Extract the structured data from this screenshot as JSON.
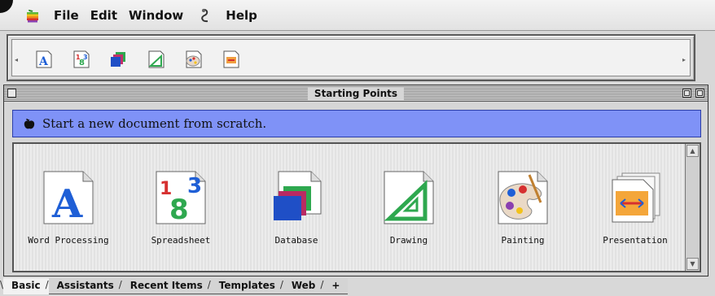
{
  "menubar": {
    "items": [
      "File",
      "Edit",
      "Window",
      "Help"
    ]
  },
  "buttonbar": {
    "buttons": [
      "word-processing",
      "spreadsheet",
      "database",
      "drawing",
      "painting",
      "presentation"
    ]
  },
  "window": {
    "title": "Starting Points",
    "banner": "Start a new document from scratch.",
    "items": [
      {
        "label": "Word Processing",
        "icon": "word-processing-icon"
      },
      {
        "label": "Spreadsheet",
        "icon": "spreadsheet-icon"
      },
      {
        "label": "Database",
        "icon": "database-icon"
      },
      {
        "label": "Drawing",
        "icon": "drawing-icon"
      },
      {
        "label": "Painting",
        "icon": "painting-icon"
      },
      {
        "label": "Presentation",
        "icon": "presentation-icon"
      }
    ]
  },
  "tabs": [
    {
      "label": "Basic",
      "active": true
    },
    {
      "label": "Assistants"
    },
    {
      "label": "Recent Items"
    },
    {
      "label": "Templates"
    },
    {
      "label": "Web"
    },
    {
      "label": "+"
    }
  ],
  "colors": {
    "banner": "#7f92f7",
    "accent_blue": "#1f5fd6",
    "accent_green": "#2ea84f",
    "accent_red": "#d63030"
  }
}
